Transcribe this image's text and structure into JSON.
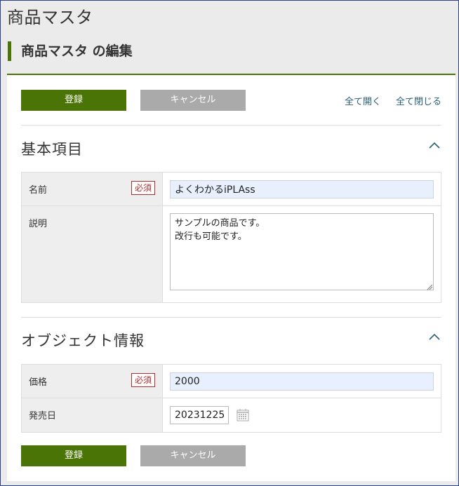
{
  "app": {
    "title": "商品マスタ"
  },
  "page": {
    "heading": "商品マスタ の編集"
  },
  "actions": {
    "save_label": "登録",
    "cancel_label": "キャンセル",
    "expand_all": "全て開く",
    "collapse_all": "全て閉じる"
  },
  "sections": {
    "basic": {
      "title": "基本項目",
      "collapse_icon": "chevron-up-icon",
      "name": {
        "label": "名前",
        "required": "必須",
        "value": "よくわかるiPLAss"
      },
      "description": {
        "label": "説明",
        "value": "サンプルの商品です。\n改行も可能です。"
      }
    },
    "object": {
      "title": "オブジェクト情報",
      "collapse_icon": "chevron-up-icon",
      "price": {
        "label": "価格",
        "required": "必須",
        "value": "2000"
      },
      "release_date": {
        "label": "発売日",
        "value": "20231225",
        "icon": "calendar-icon"
      }
    }
  },
  "colors": {
    "accent": "#4a7406",
    "secondary_button": "#aaaaaa",
    "link": "#2a5f78",
    "required": "#b32d2d",
    "input_fill": "#e8f0fe"
  }
}
